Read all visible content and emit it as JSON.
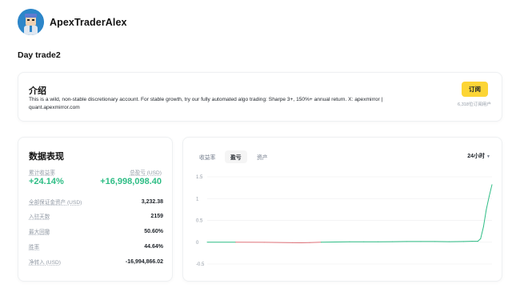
{
  "profile": {
    "username": "ApexTraderAlex"
  },
  "page_title": "Day trade2",
  "intro": {
    "title": "介绍",
    "description": "This is a wild, non-stable discretionary account. For stable growth, try our fully automated algo trading: Sharpe 3+, 150%+ annual return. X: apexmirror | quant.apexmirror.com",
    "subscribe_label": "订阅",
    "subscriber_count": "6,318位订阅用户"
  },
  "stats": {
    "title": "数据表现",
    "cumulative_return_label": "累计收益率",
    "cumulative_return_value": "+24.14%",
    "total_pnl_label": "总盈亏 (USD)",
    "total_pnl_value": "+16,998,098.40",
    "rows": [
      {
        "label": "全部保证金资产 (USD)",
        "value": "3,232.38"
      },
      {
        "label": "入驻天数",
        "value": "2159"
      },
      {
        "label": "最大回撤",
        "value": "50.60%"
      },
      {
        "label": "胜率",
        "value": "44.64%"
      },
      {
        "label": "净转入 (USD)",
        "value": "-16,994,866.02"
      }
    ]
  },
  "chart_tabs": [
    "收益率",
    "盈亏",
    "资产"
  ],
  "active_tab": "盈亏",
  "time_range": "24小时",
  "colors": {
    "accent": "#fcd535",
    "positive": "#2ebd85",
    "negative": "#e0737a",
    "text": "#1e2329",
    "muted": "#929aa5"
  },
  "chart_data": {
    "type": "line",
    "title": "",
    "xlabel": "",
    "ylabel": "",
    "ylim": [
      -0.5,
      1.5
    ],
    "yticks": [
      "1.5",
      "1",
      "0.5",
      "0",
      "-0.5"
    ],
    "ytick_values": [
      1.5,
      1,
      0.5,
      0,
      -0.5
    ],
    "grid": true,
    "series": [
      {
        "x": [
          0,
          10,
          20,
          30,
          33,
          36,
          40,
          45,
          50,
          55,
          60,
          65,
          70,
          75,
          80,
          85,
          90,
          93,
          95,
          96,
          97,
          98,
          99,
          100
        ],
        "y": [
          0,
          0,
          -0.003,
          -0.012,
          -0.014,
          -0.01,
          0,
          0.005,
          0.01,
          0.01,
          0.01,
          0.012,
          0.015,
          0.015,
          0.015,
          0.012,
          0.015,
          0.02,
          0.02,
          0.08,
          0.35,
          0.75,
          1.05,
          1.32
        ]
      }
    ]
  }
}
